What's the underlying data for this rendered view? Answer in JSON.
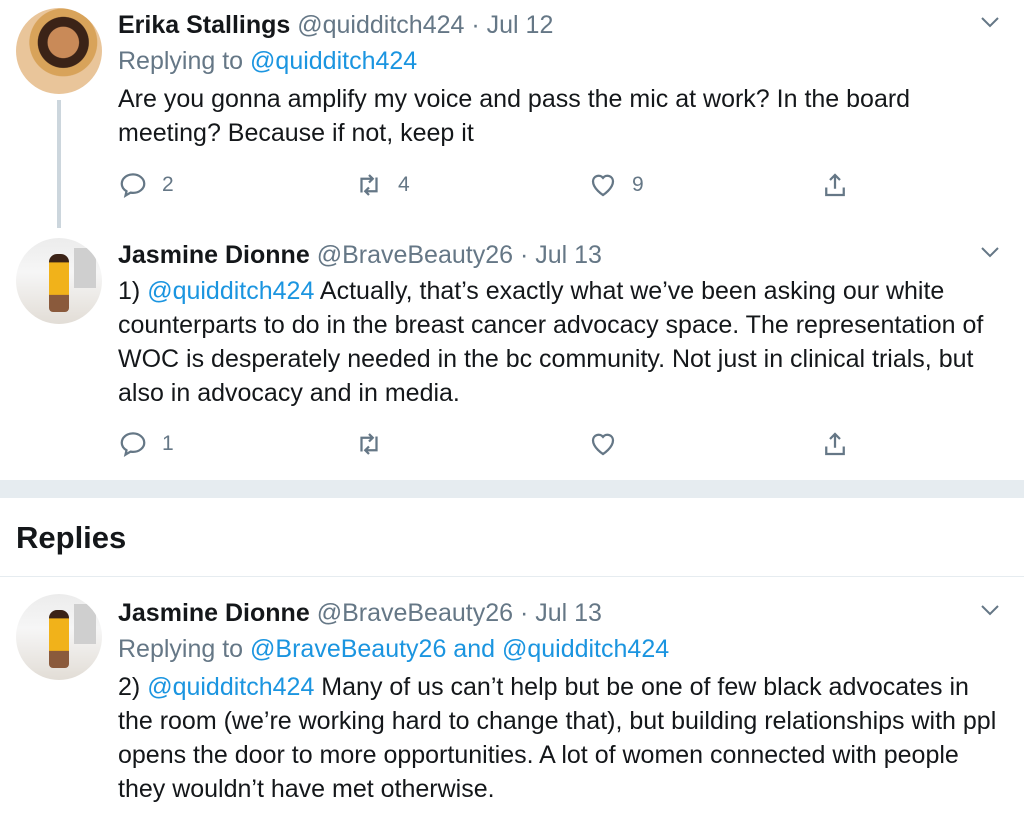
{
  "tweets": [
    {
      "name": "Erika Stallings",
      "handle": "@quidditch424",
      "dot": "·",
      "date": "Jul 12",
      "replying_prefix": "Replying to",
      "replying_to": "@quidditch424",
      "text": "Are you gonna amplify my voice and pass the mic at work? In the board meeting? Because if not, keep it",
      "replies": "2",
      "retweets": "4",
      "likes": "9"
    },
    {
      "name": "Jasmine Dionne",
      "handle": "@BraveBeauty26",
      "dot": "·",
      "date": "Jul 13",
      "text_prefix": "1) ",
      "mention": "@quidditch424",
      "text": " Actually, that’s exactly what we’ve been asking our white counterparts to do in the breast cancer advocacy space. The representation of WOC is desperately needed in the bc community. Not just in clinical trials, but also in advocacy and in media.",
      "replies": "1",
      "retweets": "",
      "likes": ""
    }
  ],
  "replies_section": {
    "title": "Replies",
    "tweet": {
      "name": "Jasmine Dionne",
      "handle": "@BraveBeauty26",
      "dot": "·",
      "date": "Jul 13",
      "replying_prefix": "Replying to",
      "replying_to": "@BraveBeauty26 and @quidditch424",
      "text_prefix": "2) ",
      "mention": "@quidditch424",
      "text": " Many of us can’t help but be one of few black advocates in the room (we’re working hard to change that), but building relationships with ppl opens the door to more opportunities. A lot of women connected with people they wouldn’t have met otherwise."
    }
  },
  "icons": {
    "reply": "reply-icon",
    "retweet": "retweet-icon",
    "like": "like-icon",
    "share": "share-icon",
    "caret": "chevron-down-icon"
  },
  "colors": {
    "link": "#1b95e0",
    "secondary": "#657786",
    "thread_line": "#ccd6dd",
    "separator": "#e6ecf0"
  }
}
